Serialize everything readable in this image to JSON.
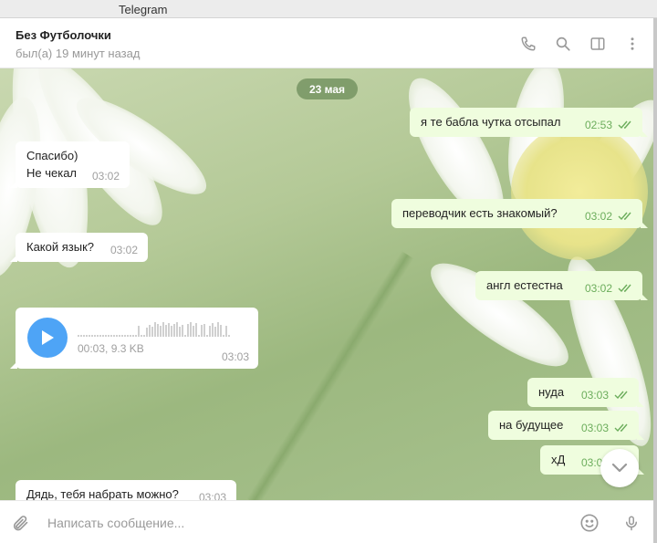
{
  "window": {
    "title": "Telegram"
  },
  "header": {
    "name": "Без Футболочки",
    "status": "был(а) 19 минут назад"
  },
  "chat": {
    "date": "23 мая",
    "messages": [
      {
        "dir": "out",
        "text": "я те бабла чутка отсыпал",
        "time": "02:53",
        "read": true
      },
      {
        "dir": "in",
        "text": "Спасибо)",
        "text2": "Не чекал",
        "time": "03:02"
      },
      {
        "dir": "out",
        "text": "переводчик есть знакомый?",
        "time": "03:02",
        "read": true
      },
      {
        "dir": "in",
        "text": "Какой язык?",
        "time": "03:02"
      },
      {
        "dir": "out",
        "text": "англ естестна",
        "time": "03:02",
        "read": true
      },
      {
        "dir": "in",
        "type": "voice",
        "duration": "00:03, 9.3 KB",
        "time": "03:03"
      },
      {
        "dir": "out",
        "text": "нуда",
        "time": "03:03",
        "read": true
      },
      {
        "dir": "out",
        "text": "на будущее",
        "time": "03:03",
        "read": true
      },
      {
        "dir": "out",
        "text": "хД",
        "time": "03:03",
        "read": true
      },
      {
        "dir": "in",
        "text": "Дядь, тебя набрать можно?",
        "time": "03:03"
      }
    ]
  },
  "composer": {
    "placeholder": "Написать сообщение..."
  },
  "icons": {
    "header": [
      "phone-icon",
      "search-icon",
      "sidebar-toggle-icon",
      "more-icon"
    ],
    "composer": [
      "attach-icon",
      "emoji-icon",
      "mic-icon"
    ],
    "chat": [
      "play-icon",
      "chevron-down-icon",
      "read-check-icon"
    ]
  },
  "colors": {
    "accent": "#4ea4f6",
    "outgoing_bubble": "#effdde",
    "incoming_bubble": "#ffffff",
    "time_out": "#6cad5c",
    "date_pill": "#6c8c5a"
  }
}
